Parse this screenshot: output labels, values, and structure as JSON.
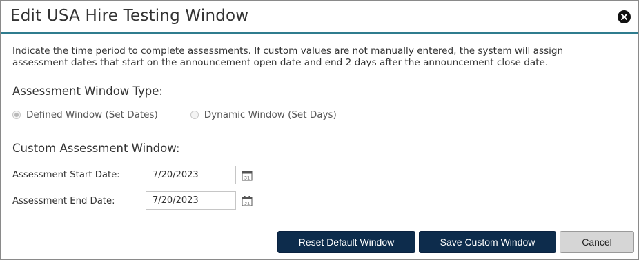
{
  "dialog": {
    "title": "Edit USA Hire Testing Window",
    "intro": "Indicate the time period to complete assessments.  If custom values are not manually entered, the system will assign assessment dates that start on the announcement open date and end 2 days after the announcement close date."
  },
  "window_type": {
    "heading": "Assessment Window Type:",
    "options": [
      {
        "label": "Defined Window (Set Dates)",
        "checked": true
      },
      {
        "label": "Dynamic Window (Set Days)",
        "checked": false
      }
    ]
  },
  "custom_window": {
    "heading": "Custom Assessment Window:",
    "start_label": "Assessment Start Date:",
    "start_value": "7/20/2023",
    "end_label": "Assessment End Date:",
    "end_value": "7/20/2023",
    "calendar_icon_text": "31"
  },
  "buttons": {
    "reset": "Reset Default Window",
    "save": "Save Custom Window",
    "cancel": "Cancel"
  },
  "icons": {
    "close": "close-icon",
    "calendar": "calendar-icon"
  },
  "colors": {
    "header_rule": "#2f7c8e",
    "primary_button": "#0d2c4c",
    "secondary_button": "#d6d6d6"
  }
}
